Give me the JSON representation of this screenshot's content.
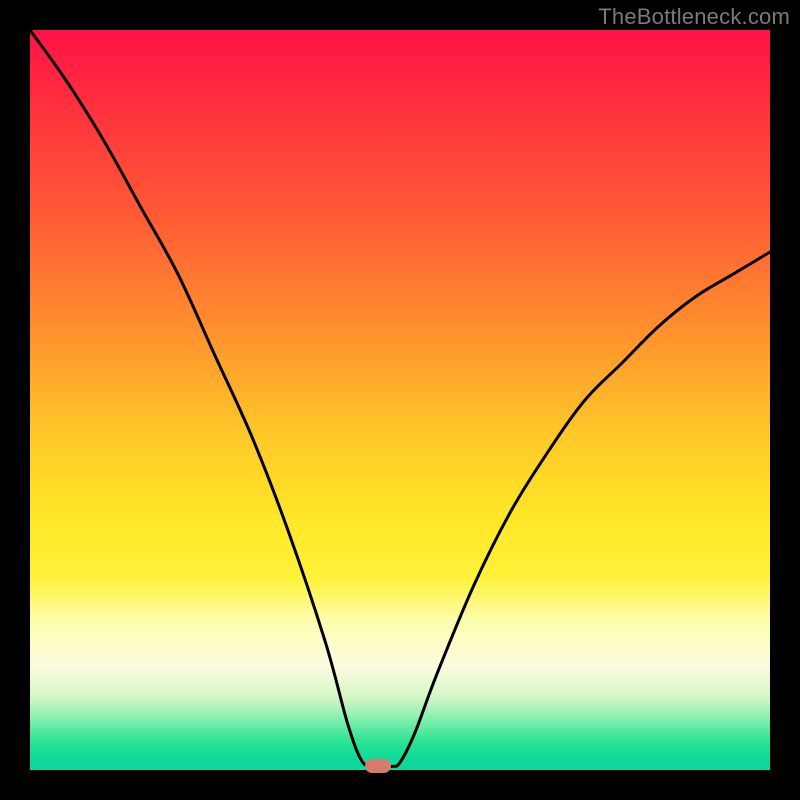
{
  "watermark": "TheBottleneck.com",
  "chart_data": {
    "type": "line",
    "title": "",
    "xlabel": "",
    "ylabel": "",
    "xlim": [
      0,
      100
    ],
    "ylim": [
      0,
      100
    ],
    "series": [
      {
        "name": "bottleneck-curve",
        "x": [
          0,
          5,
          10,
          15,
          20,
          25,
          30,
          35,
          40,
          43,
          45,
          47,
          48,
          49,
          50,
          52,
          55,
          60,
          65,
          70,
          75,
          80,
          85,
          90,
          95,
          100
        ],
        "y": [
          100,
          93,
          85,
          76,
          67,
          56,
          45,
          32,
          17,
          6,
          1,
          0.5,
          0.5,
          0.5,
          1,
          5,
          13,
          25,
          35,
          43,
          50,
          55,
          60,
          64,
          67,
          70
        ]
      }
    ],
    "marker": {
      "x": 47,
      "y": 0.5
    },
    "gradient_stops": [
      {
        "pos": 0,
        "color": "#ff1247"
      },
      {
        "pos": 25,
        "color": "#ff5a35"
      },
      {
        "pos": 55,
        "color": "#ffc928"
      },
      {
        "pos": 80,
        "color": "#fdfdb0"
      },
      {
        "pos": 96,
        "color": "#2fe493"
      },
      {
        "pos": 100,
        "color": "#0fd79e"
      }
    ]
  }
}
